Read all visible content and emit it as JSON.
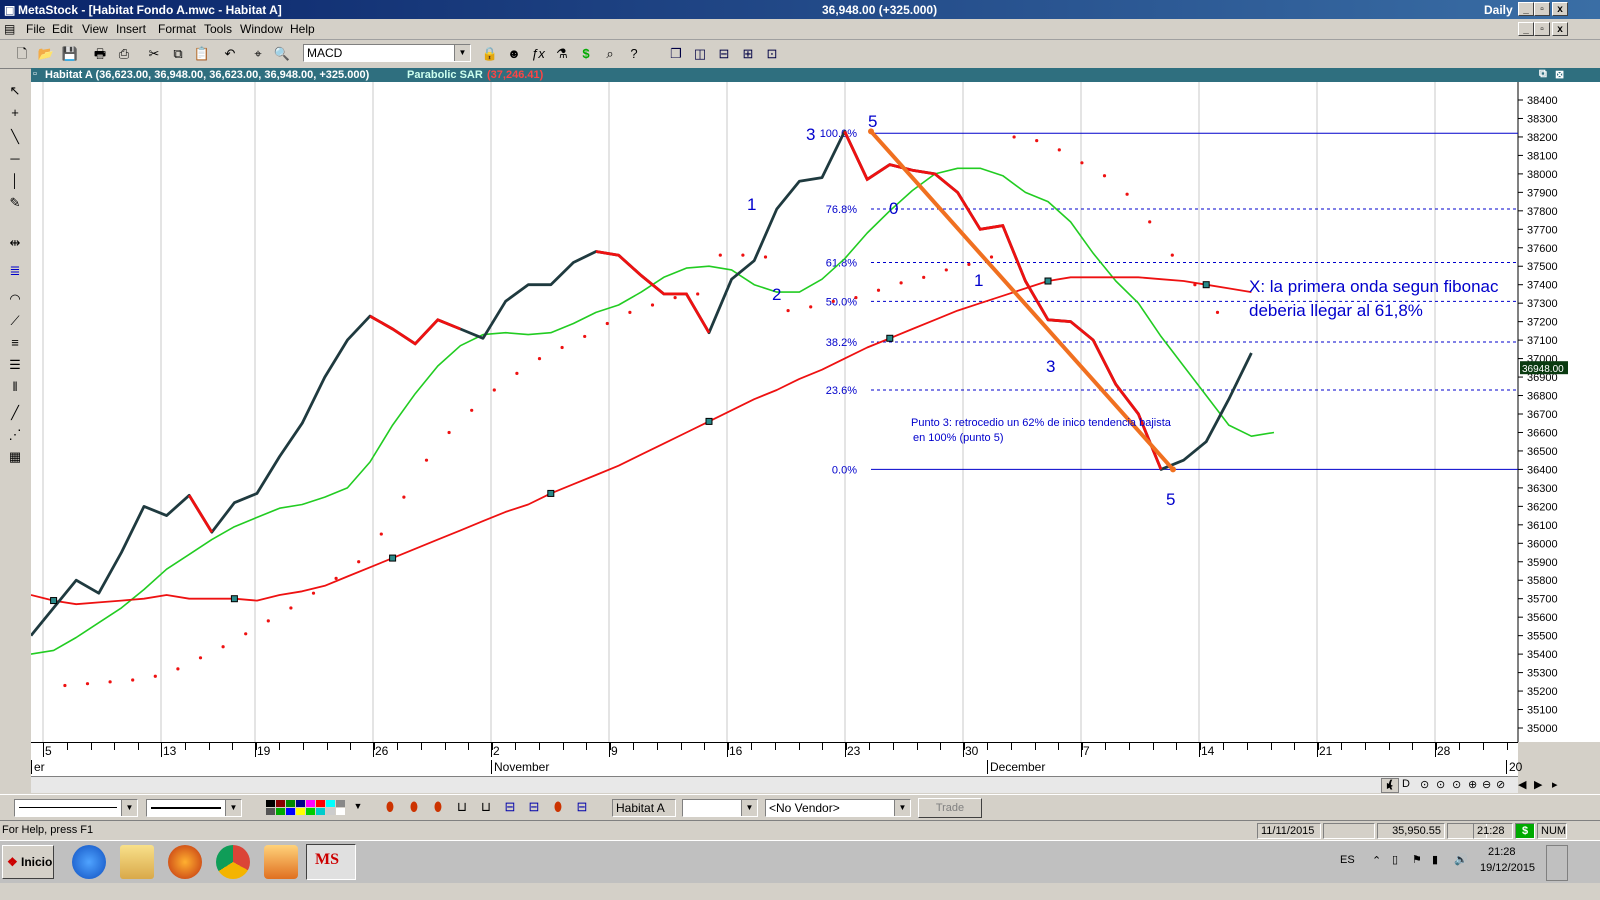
{
  "window": {
    "title": "MetaStock - [Habitat Fondo A.mwc - Habitat A]",
    "center_readout": "36,948.00 (+325.000)",
    "periodicity": "Daily",
    "min_label": "_",
    "max_label": "▫",
    "close_label": "x"
  },
  "menu": [
    "File",
    "Edit",
    "View",
    "Insert",
    "Format",
    "Tools",
    "Window",
    "Help"
  ],
  "toolbar": {
    "indicator_select": "MACD",
    "icons": [
      "new-icon",
      "open-icon",
      "save-icon",
      "print-icon",
      "print-preview-icon",
      "cut-icon",
      "copy-icon",
      "paste-icon",
      "undo-icon",
      "crosshair-icon",
      "zoom-icon"
    ]
  },
  "chart_header": {
    "security_label": "Habitat A (36,623.00, 36,948.00, 36,623.00, 36,948.00, +325.000)",
    "indicator_label": "Parabolic SAR",
    "indicator_value": "(37,246.41)"
  },
  "chart_data": {
    "type": "line",
    "ylim": [
      34900,
      38500
    ],
    "y_ticks": [
      35000,
      35100,
      35200,
      35300,
      35400,
      35500,
      35600,
      35700,
      35800,
      35900,
      36000,
      36100,
      36200,
      36300,
      36400,
      36500,
      36600,
      36700,
      36800,
      36900,
      37000,
      37100,
      37200,
      37300,
      37400,
      37500,
      37600,
      37700,
      37800,
      37900,
      38000,
      38100,
      38200,
      38300,
      38400
    ],
    "last_price_label": "36948.00",
    "x_tick_labels": [
      "5",
      "13",
      "19",
      "26",
      "2",
      "9",
      "16",
      "23",
      "30",
      "7",
      "14",
      "21",
      "28"
    ],
    "month_labels": [
      "er",
      "November",
      "December",
      "20"
    ],
    "price_series": [
      35500,
      35650,
      35800,
      35730,
      35950,
      36200,
      36150,
      36260,
      36060,
      36220,
      36270,
      36470,
      36650,
      36900,
      37100,
      37230,
      37160,
      37080,
      37210,
      37160,
      37110,
      37310,
      37400,
      37400,
      37520,
      37580,
      37560,
      37450,
      37350,
      37350,
      37140,
      37430,
      37530,
      37810,
      37960,
      37980,
      38230,
      37970,
      38050,
      38020,
      38000,
      37900,
      37700,
      37720,
      37420,
      37210,
      37200,
      37100,
      36860,
      36700,
      36400,
      36450,
      36550,
      36780,
      37030
    ],
    "red_series": [
      35720,
      35690,
      35670,
      35680,
      35690,
      35700,
      35720,
      35700,
      35700,
      35700,
      35690,
      35720,
      35740,
      35770,
      35820,
      35870,
      35920,
      35970,
      36020,
      36070,
      36120,
      36170,
      36210,
      36270,
      36320,
      36370,
      36420,
      36480,
      36540,
      36600,
      36660,
      36720,
      36780,
      36830,
      36890,
      36940,
      37000,
      37060,
      37110,
      37160,
      37210,
      37260,
      37300,
      37340,
      37380,
      37420,
      37440,
      37440,
      37440,
      37440,
      37430,
      37420,
      37400,
      37380,
      37360
    ],
    "green_series": [
      35400,
      35420,
      35490,
      35570,
      35650,
      35750,
      35860,
      35940,
      36020,
      36090,
      36140,
      36190,
      36210,
      36250,
      36300,
      36440,
      36640,
      36810,
      36960,
      37070,
      37130,
      37140,
      37130,
      37140,
      37190,
      37250,
      37290,
      37360,
      37440,
      37490,
      37500,
      37480,
      37400,
      37360,
      37360,
      37430,
      37540,
      37680,
      37800,
      37910,
      38000,
      38030,
      38030,
      37990,
      37900,
      37850,
      37740,
      37570,
      37420,
      37300,
      37120,
      36960,
      36800,
      36640,
      36580,
      36600
    ],
    "sar_series": [
      35230,
      35240,
      35250,
      35260,
      35280,
      35320,
      35380,
      35440,
      35510,
      35580,
      35650,
      35730,
      35810,
      35900,
      36050,
      36250,
      36450,
      36600,
      36720,
      36830,
      36920,
      37000,
      37060,
      37120,
      37190,
      37250,
      37290,
      37330,
      37350,
      37560,
      37560,
      37550,
      37260,
      37280,
      37310,
      37330,
      37370,
      37410,
      37440,
      37480,
      37510,
      37550,
      38200,
      38180,
      38130,
      38060,
      37990,
      37890,
      37740,
      37560,
      37400,
      37250
    ],
    "fib_levels": [
      {
        "label": "100.0%",
        "value": 38220
      },
      {
        "label": "76.8%",
        "value": 37810
      },
      {
        "label": "61.8%",
        "value": 37520
      },
      {
        "label": "50.0%",
        "value": 37310
      },
      {
        "label": "38.2%",
        "value": 37090
      },
      {
        "label": "23.6%",
        "value": 36830
      },
      {
        "label": "0.0%",
        "value": 36400
      }
    ],
    "wave_labels": [
      "3",
      "5",
      "1",
      "0",
      "2",
      "1",
      "3",
      "5"
    ],
    "annotations": {
      "x_note_line1": "X: la primera onda segun fibonac",
      "x_note_line2": "deberia llegar al 61,8%",
      "punto3_line1": "Punto 3: retrocedio un 62% de inico tendencia bajista",
      "punto3_line2": "en 100% (punto 5)"
    },
    "colors": {
      "price": "#1f3a3f",
      "red": "#ee1111",
      "green": "#22cc22",
      "sar": "#ee1111",
      "fib": "#0000cc",
      "trend": "#f07020"
    }
  },
  "bottom_toolbar": {
    "security_box": "Habitat A",
    "vendor_select": "<No Vendor>",
    "trade_button": "Trade"
  },
  "status": {
    "help": "For Help, press F1",
    "date": "11/11/2015",
    "value": "35,950.55",
    "time": "21:28",
    "dollar": "$",
    "num": "NUM"
  },
  "taskbar": {
    "start_label": "Inicio",
    "lang": "ES",
    "clock_time": "21:28",
    "clock_date": "19/12/2015",
    "app_label": "MS"
  }
}
